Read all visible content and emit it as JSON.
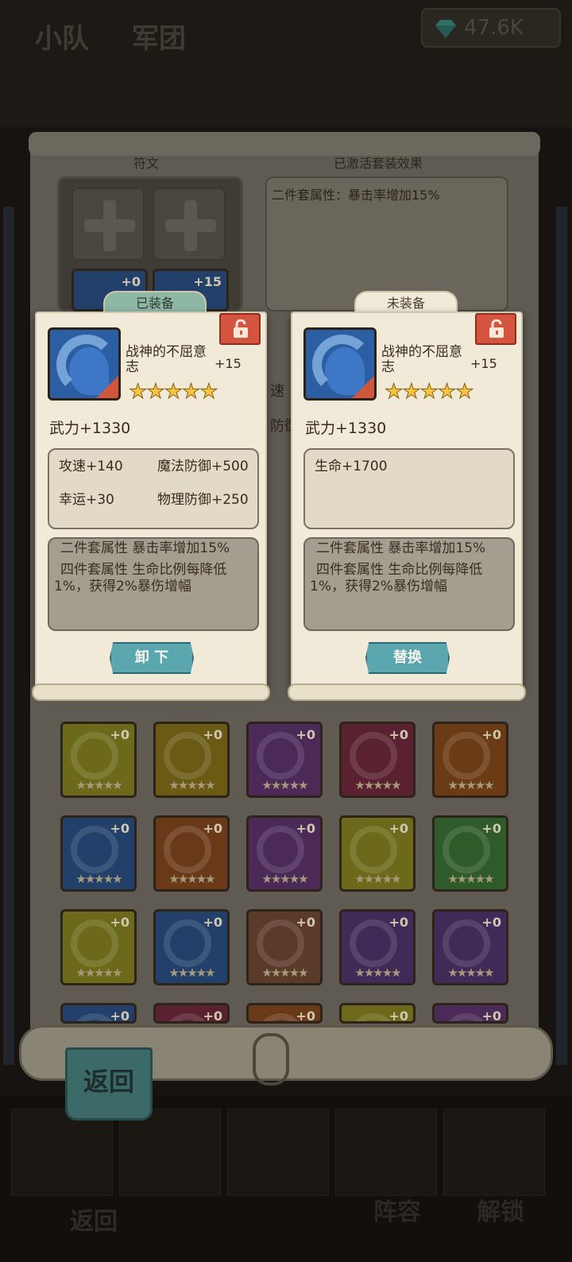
{
  "background": {
    "top_tabs": [
      "小队",
      "军团"
    ],
    "gems": "47.6K",
    "bottom_back_label": "返回",
    "bottom_right_labels": [
      "阵容",
      "解锁"
    ]
  },
  "panel": {
    "rune_header": "符文",
    "set_header": "已激活套装效果",
    "active_set_effect": "二件套属性：暴击率增加15%",
    "partial_texts": [
      "速",
      "防御"
    ],
    "back_label": "返回"
  },
  "rune_grid": [
    {
      "level": "+0",
      "stars": "★★★★★",
      "color": "#6c6a1a"
    },
    {
      "level": "+0",
      "stars": "★★★★★",
      "color": "#6a5a14"
    },
    {
      "level": "+0",
      "stars": "★★★★★",
      "color": "#4b2a58"
    },
    {
      "level": "+0",
      "stars": "★★★★★",
      "color": "#5a2230"
    },
    {
      "level": "+0",
      "stars": "★★★★★",
      "color": "#6a3b14"
    },
    {
      "level": "+0",
      "stars": "★★★★★",
      "color": "#22406a"
    },
    {
      "level": "+0",
      "stars": "★★★★★",
      "color": "#6a3a18"
    },
    {
      "level": "+0",
      "stars": "★★★★★",
      "color": "#4b2a58"
    },
    {
      "level": "+0",
      "stars": "★★★★★",
      "color": "#6c6a1a"
    },
    {
      "level": "+0",
      "stars": "★★★★★",
      "color": "#2f5a2a"
    },
    {
      "level": "+0",
      "stars": "★★★★★",
      "color": "#6c6a1a"
    },
    {
      "level": "+0",
      "stars": "★★★★★",
      "color": "#22406a"
    },
    {
      "level": "+0",
      "stars": "★★★★★",
      "color": "#5a3a28"
    },
    {
      "level": "+0",
      "stars": "★★★★★",
      "color": "#3f2a58"
    },
    {
      "level": "+0",
      "stars": "★★★★★",
      "color": "#3f2a58"
    },
    {
      "level": "+0",
      "stars": "",
      "color": "#22406a"
    },
    {
      "level": "+0",
      "stars": "",
      "color": "#5a2230"
    },
    {
      "level": "+0",
      "stars": "",
      "color": "#6a3a18"
    },
    {
      "level": "+0",
      "stars": "",
      "color": "#6c6a1a"
    },
    {
      "level": "+0",
      "stars": "",
      "color": "#4b2a58"
    }
  ],
  "peek_runes": [
    "+0",
    "+15"
  ],
  "equipped_card": {
    "tab_label": "已装备",
    "name": "战神的不屈意志",
    "level": "+15",
    "stars": "★★★★★",
    "main_stat": "武力+1330",
    "stats": [
      "攻速+140",
      "魔法防御+500",
      "幸运+30",
      "物理防御+250"
    ],
    "set_effects": [
      "二件套属性 暴击率增加15%",
      "四件套属性 生命比例每降低1%，获得2%暴伤增幅"
    ],
    "action_label": "卸 下"
  },
  "unequipped_card": {
    "tab_label": "未装备",
    "name": "战神的不屈意志",
    "level": "+15",
    "stars": "★★★★★",
    "main_stat": "武力+1330",
    "stats": [
      "生命+1700"
    ],
    "set_effects": [
      "二件套属性 暴击率增加15%",
      "四件套属性 生命比例每降低1%，获得2%暴伤增幅"
    ],
    "action_label": "替换"
  },
  "colors": {
    "rune_blue": "#2c5ea4",
    "lock_red": "#d4553f",
    "star_gold": "#f2c640",
    "button_teal": "#5ba7b0",
    "card_bg": "#f1ead8"
  }
}
